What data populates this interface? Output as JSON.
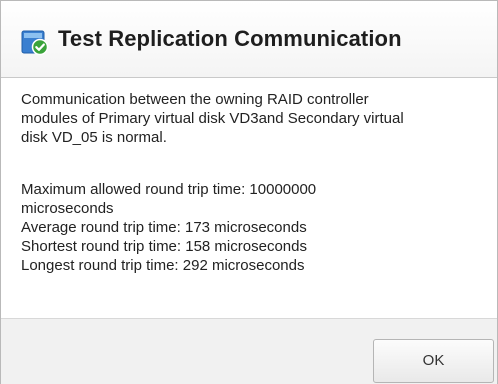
{
  "dialog": {
    "title": "Test Replication Communication",
    "title_icon": "check-shield-icon",
    "message_lines": [
      "Communication between the owning RAID controller",
      "modules of Primary virtual disk VD3and Secondary virtual",
      "disk VD_05 is normal."
    ],
    "stats_lines": [
      "Maximum allowed round trip time: 10000000",
      "microseconds",
      "Average round trip time: 173 microseconds",
      "Shortest round trip time: 158 microseconds",
      "Longest round trip time: 292 microseconds"
    ],
    "ok_label": "OK"
  },
  "colors": {
    "title_icon_blue": "#3a7fd0",
    "title_icon_green": "#3aa33a",
    "footer_bg": "#f1f1f1"
  }
}
